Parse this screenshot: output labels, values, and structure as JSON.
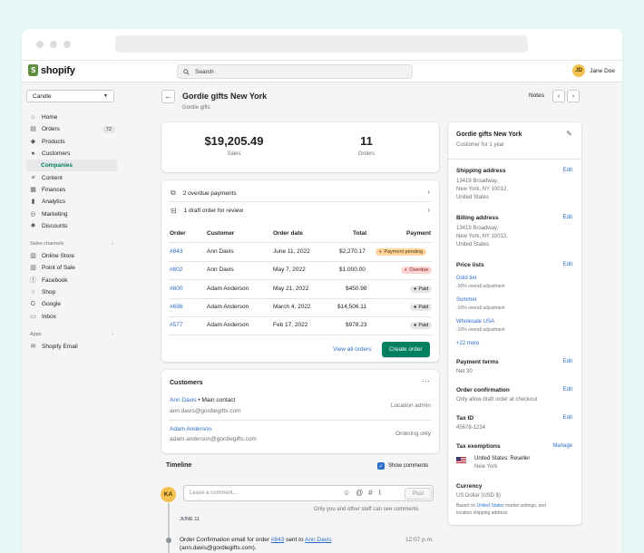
{
  "app": {
    "logo": "shopify",
    "search_placeholder": "Search",
    "user_initials": "JD",
    "user_name": "Jane Doe"
  },
  "sidebar": {
    "store": "Candle",
    "items": [
      {
        "label": "Home",
        "icon": "home-icon"
      },
      {
        "label": "Orders",
        "icon": "orders-icon",
        "badge": "72"
      },
      {
        "label": "Products",
        "icon": "products-icon"
      },
      {
        "label": "Customers",
        "icon": "customers-icon"
      },
      {
        "label": "Companies",
        "icon": ""
      },
      {
        "label": "Content",
        "icon": "content-icon"
      },
      {
        "label": "Finances",
        "icon": "finances-icon"
      },
      {
        "label": "Analytics",
        "icon": "analytics-icon"
      },
      {
        "label": "Marketing",
        "icon": "marketing-icon"
      },
      {
        "label": "Discounts",
        "icon": "discounts-icon"
      }
    ],
    "sales_channels_label": "Sales channels",
    "channels": [
      "Online Store",
      "Point of Sale",
      "Facebook",
      "Shop",
      "Google",
      "Inbox"
    ],
    "apps_label": "Apps",
    "apps": [
      "Shopify Email"
    ]
  },
  "page": {
    "title": "Gordie gifts New York",
    "subtitle": "Gordie gifts",
    "notes": "Notes"
  },
  "stats": {
    "sales_value": "$19,205.49",
    "sales_label": "Sales",
    "orders_value": "11",
    "orders_label": "Orders"
  },
  "alerts": [
    "2 overdue payments",
    "1 draft order for review"
  ],
  "orders_table": {
    "headers": [
      "Order",
      "Customer",
      "Order date",
      "Total",
      "Payment"
    ],
    "rows": [
      {
        "order": "#843",
        "customer": "Ann Davis",
        "date": "June 11, 2022",
        "total": "$2,270.17",
        "payment": "Payment pending",
        "status": "pending"
      },
      {
        "order": "#802",
        "customer": "Ann Davis",
        "date": "May 7, 2022",
        "total": "$1,000.00",
        "payment": "Overdue",
        "status": "overdue"
      },
      {
        "order": "#600",
        "customer": "Adam Anderson",
        "date": "May 21, 2022",
        "total": "$450.98",
        "payment": "Paid",
        "status": "paid"
      },
      {
        "order": "#698",
        "customer": "Adam Anderson",
        "date": "March 4, 2022",
        "total": "$14,506.11",
        "payment": "Paid",
        "status": "paid"
      },
      {
        "order": "#577",
        "customer": "Adam Anderson",
        "date": "Feb 17, 2022",
        "total": "$978.23",
        "payment": "Paid",
        "status": "paid"
      }
    ],
    "view_all": "View all orders",
    "create": "Create order"
  },
  "customers_card": {
    "title": "Customers",
    "list": [
      {
        "name": "Ann Davis",
        "role": " • Main contact",
        "email": "ann.davis@gordiegifts.com",
        "permission": "Location admin"
      },
      {
        "name": "Adam Anderson",
        "role": "",
        "email": "adam.anderson@gordiegifts.com",
        "permission": "Ordering only"
      }
    ]
  },
  "timeline": {
    "title": "Timeline",
    "show_comments": "Show comments",
    "avatar": "KA",
    "placeholder": "Leave a comment...",
    "post": "Post",
    "hint": "Only you and other staff can see comments",
    "date": "JUNE 11",
    "event_pre": "Order Confirmation email for order ",
    "event_order": "#843",
    "event_mid": " sent to ",
    "event_name": "Ann Davis",
    "event_email": "(ann.davis@gordiegifts.com).",
    "event_time": "12:07 p.m."
  },
  "details": {
    "title": "Gordie gifts New York",
    "since": "Customer for 1 year",
    "edit": "Edit",
    "shipping_label": "Shipping address",
    "shipping": [
      "13419 Broadway,",
      "New York, NY 10012,",
      "United States"
    ],
    "billing_label": "Billing address",
    "billing": [
      "13419 Broadway,",
      "New York, NY 10012,",
      "United States"
    ],
    "price_lists_label": "Price lists",
    "price_lists": [
      {
        "name": "Gold tier",
        "note": "-30% overall adjustment"
      },
      {
        "name": "Summer",
        "note": "-10% overall adjustment"
      },
      {
        "name": "Wholesale USA",
        "note": "-10% overall adjustment"
      }
    ],
    "more": "+22 more",
    "payment_terms_label": "Payment terms",
    "payment_terms": "Net 30",
    "order_conf_label": "Order confirmation",
    "order_conf": "Only allow draft order at checkout",
    "tax_id_label": "Tax ID",
    "tax_id": "45678-1234",
    "tax_ex_label": "Tax exemptions",
    "manage": "Manage",
    "tax_ex_1": "United States: Reseller",
    "tax_ex_2": "New York",
    "currency_label": "Currency",
    "currency": "US Dollar (USD $)",
    "currency_note_1": "Based on ",
    "currency_note_link": "United States",
    "currency_note_2": " market settings, and",
    "currency_note_3": "location shipping address."
  },
  "colors": {
    "primary": "#008060",
    "link": "#2c6ecb",
    "background": "#e8f6f6"
  }
}
